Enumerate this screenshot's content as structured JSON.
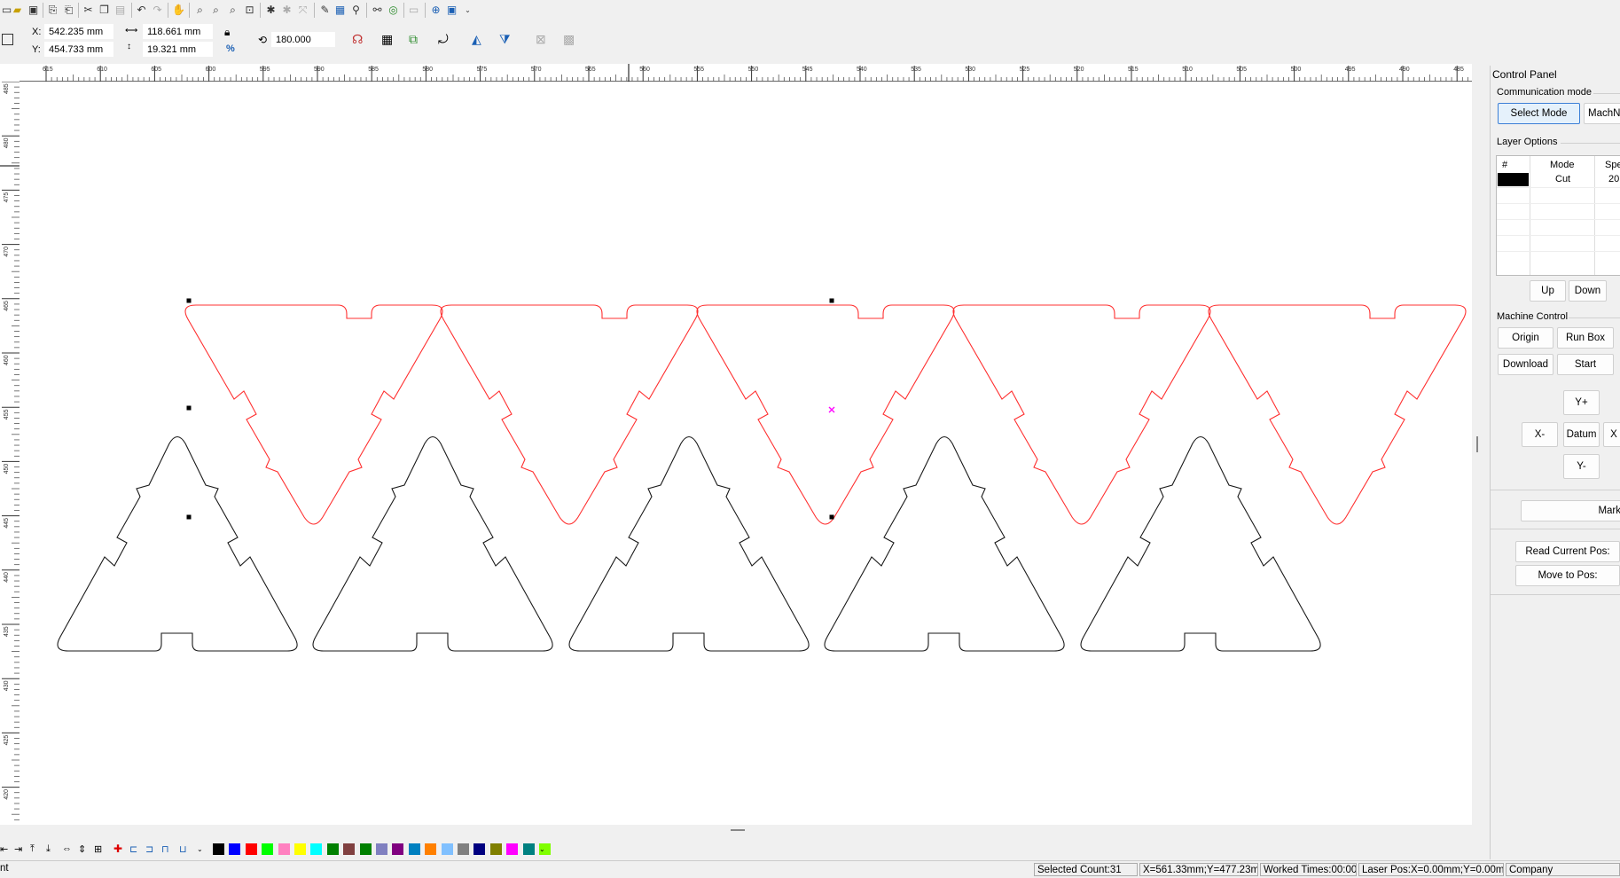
{
  "toolbar": {
    "icons": [
      "new-icon",
      "open-icon",
      "save-icon",
      "import-icon",
      "export-icon",
      "cut-icon",
      "copy-icon",
      "paste-icon",
      "undo-icon",
      "redo-icon",
      "pan-icon",
      "zoom-in-icon",
      "zoom-out-icon",
      "zoom-page-icon",
      "zoom-fit-icon",
      "node-icon",
      "grid-icon",
      "measure-icon",
      "pen-icon",
      "table-icon",
      "search-icon",
      "weld-icon",
      "target-icon",
      "monitor-icon",
      "globe-icon",
      "display-icon"
    ]
  },
  "props": {
    "x_label": "X:",
    "x_value": "542.235 mm",
    "y_label": "Y:",
    "y_value": "454.733 mm",
    "width_value": "118.661 mm",
    "height_value": "19.321 mm",
    "rotate_value": "180.000",
    "percent_symbol": "%"
  },
  "ruler": {
    "h_labels": [
      "615",
      "610",
      "605",
      "600",
      "595",
      "590",
      "585",
      "580",
      "575",
      "570",
      "565",
      "560",
      "555",
      "550",
      "545",
      "540",
      "535",
      "530",
      "525",
      "520",
      "515",
      "510",
      "505",
      "500",
      "495",
      "490",
      "485"
    ],
    "v_labels": [
      "485",
      "480",
      "475",
      "470",
      "465",
      "460",
      "455",
      "450",
      "445",
      "440",
      "435",
      "430",
      "425",
      "420"
    ]
  },
  "colors": {
    "cut_red": "#ff3030",
    "outline": "#1a1a1a",
    "handle": "#000000",
    "center_mark": "#ff00ff"
  },
  "palette": [
    "#000000",
    "#0000ff",
    "#ff0000",
    "#00ff00",
    "#ff80c0",
    "#ffff00",
    "#00ffff",
    "#008000",
    "#804040",
    "#008000",
    "#8080c0",
    "#800080",
    "#0080c0",
    "#ff8000",
    "#80c0ff",
    "#808080",
    "#000080",
    "#808000",
    "#ff00ff",
    "#008080",
    "#80ff00"
  ],
  "status": {
    "left_text": "nt",
    "selected": "Selected Count:31",
    "pos": "X=561.33mm;Y=477.23m",
    "worked": "Worked Times:00:00",
    "laser": "Laser Pos:X=0.00mm;Y=0.00mr",
    "company": "Company"
  },
  "panel": {
    "title": "Control Panel",
    "comm_mode_label": "Communication mode",
    "select_mode": "Select Mode",
    "machine_name": "MachNa",
    "layer_options_label": "Layer Options",
    "table_headers": [
      "#",
      "Mode",
      "Spe"
    ],
    "layer_rows": [
      {
        "color": "#000000",
        "mode": "Cut",
        "speed": "20"
      }
    ],
    "up": "Up",
    "down": "Down",
    "machine_control_label": "Machine Control",
    "origin": "Origin",
    "run_box": "Run Box",
    "download": "Download",
    "start": "Start",
    "y_plus": "Y+",
    "x_minus": "X-",
    "datum": "Datum",
    "x_plus": "X",
    "y_minus": "Y-",
    "mark": "Mark",
    "read_current_pos": "Read Current Pos:",
    "move_to_pos": "Move to Pos:"
  }
}
